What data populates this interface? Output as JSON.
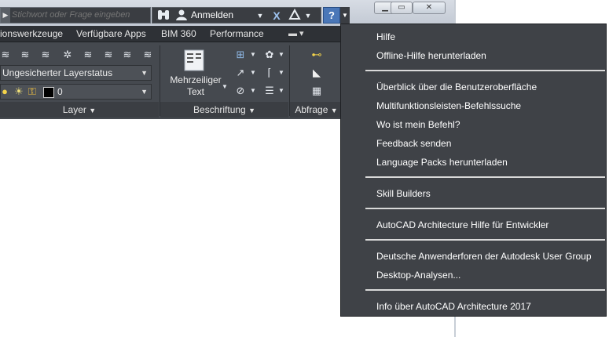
{
  "search": {
    "placeholder": "Stichwort oder Frage eingeben"
  },
  "toolbar": {
    "signin_label": "Anmelden",
    "binoculars_icon": "binoculars-icon",
    "user_icon": "user-icon",
    "exchange_icon": "x-icon",
    "a360_icon": "triangle-icon",
    "help_icon": "?"
  },
  "tabs": [
    "ionswerkzeuge",
    "Verfügbare Apps",
    "BIM 360",
    "Performance"
  ],
  "ribbon": {
    "layer_state": "Ungesicherter Layerstatus",
    "layer_current": "0",
    "panel_layer": "Layer",
    "panel_annotation": "Beschriftung",
    "panel_query": "Abfrage",
    "mtext_line1": "Mehrzeiliger",
    "mtext_line2": "Text"
  },
  "help_menu": {
    "group1": [
      "Hilfe",
      "Offline-Hilfe herunterladen"
    ],
    "group2": [
      "Überblick über die Benutzeroberfläche",
      "Multifunktionsleisten-Befehlssuche",
      "Wo ist mein Befehl?",
      "Feedback senden",
      "Language Packs herunterladen"
    ],
    "group3": [
      "Skill Builders"
    ],
    "group4": [
      "AutoCAD Architecture Hilfe für Entwickler"
    ],
    "group5": [
      "Deutsche Anwenderforen der Autodesk User Group",
      "Desktop-Analysen..."
    ],
    "group6": [
      "Info über AutoCAD Architecture 2017"
    ]
  }
}
